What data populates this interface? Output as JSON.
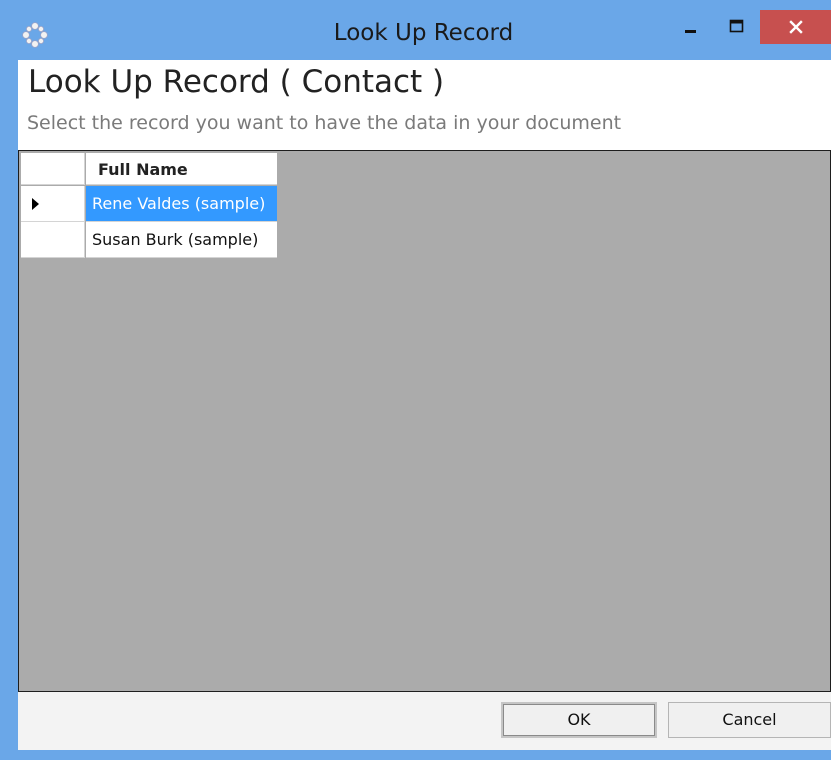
{
  "window": {
    "title": "Look Up Record",
    "accent_color": "#6aa7e8",
    "close_color": "#c7504f",
    "controls": {
      "minimize_icon": "minimize-icon",
      "maximize_icon": "maximize-icon",
      "close_icon": "close-icon"
    },
    "app_icon": "app-logo-icon"
  },
  "header": {
    "title": "Look Up Record ( Contact )",
    "subtitle": "Select the record you want to have the data in your document"
  },
  "grid": {
    "columns": [
      "Full Name"
    ],
    "rows": [
      {
        "full_name": "Rene Valdes (sample)",
        "selected": true,
        "current": true
      },
      {
        "full_name": "Susan Burk (sample)",
        "selected": false,
        "current": false
      }
    ],
    "selection_color": "#3399ff",
    "background_color": "#ababab"
  },
  "footer": {
    "ok_label": "OK",
    "cancel_label": "Cancel"
  }
}
